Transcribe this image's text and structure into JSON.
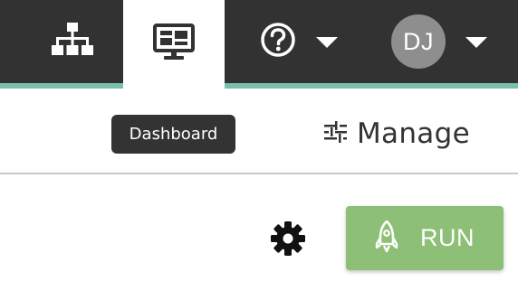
{
  "topbar": {
    "accent_color": "#79bfae",
    "background_color": "#323232",
    "items": [
      {
        "icon": "sitemap-icon",
        "label": ""
      },
      {
        "icon": "monitor-icon",
        "label": "Dashboard",
        "active": true
      },
      {
        "icon": "help-icon",
        "label": ""
      },
      {
        "icon": "avatar",
        "label": ""
      }
    ],
    "user": {
      "initials": "DJ",
      "avatar_color": "#8e8e8e"
    }
  },
  "tooltip": {
    "text": "Dashboard"
  },
  "manage": {
    "label": "Manage",
    "icon": "sliders-icon"
  },
  "actions": {
    "settings_icon": "gear-icon",
    "run_label": "RUN",
    "run_icon": "rocket-icon",
    "run_color": "#8dbf76"
  }
}
